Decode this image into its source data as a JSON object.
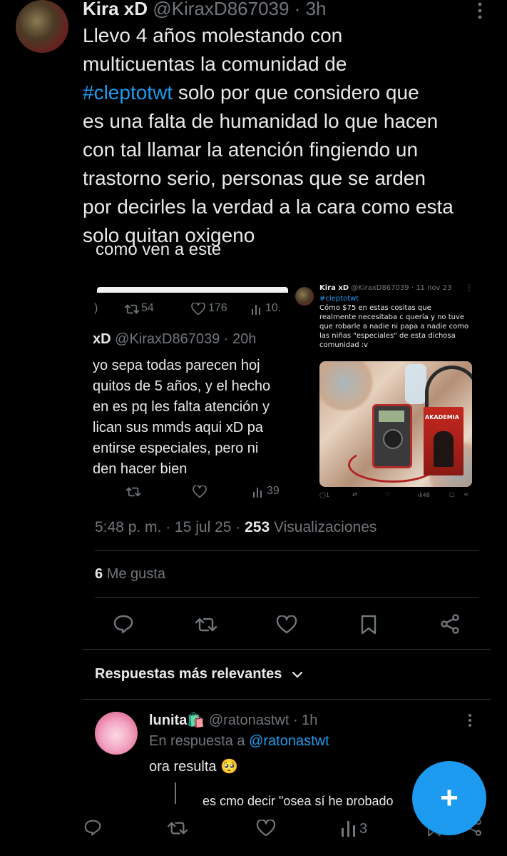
{
  "tweet": {
    "author_name": "Kira xD",
    "handle": "@KiraxD867039",
    "time": "· 3h",
    "text_lines": [
      "Llevo 4 años molestando con",
      "multicuentas la comunidad de",
      "solo por que considero que",
      "es una falta de humanidad lo que hacen",
      "con tal llamar la atención fingiendo un",
      "trastorno serio, personas que se arden",
      "por decirles la verdad a la cara como esta",
      "solo quitan oxigeno"
    ],
    "hashtag": "#cleptotwt",
    "cut_caption": "como ven a este",
    "timestamp": "5:48 p. m. · 15 jul 25 ·",
    "views_count": "253",
    "views_label": "Visualizaciones",
    "likes_count": "6",
    "likes_label": "Me gusta"
  },
  "left_screenshot": {
    "retweets": "54",
    "likes": "176",
    "views": "10.",
    "header_name": "xD",
    "header_handle": "@KiraxD867039 · 20h",
    "lines": [
      "yo sepa todas parecen hoj",
      "quitos de 5 años, y el hecho",
      "en es pq les falta atención y",
      "lican sus mmds aqui xD pa",
      "entirse especiales, pero ni",
      "den hacer bien"
    ],
    "bottom_views": "39"
  },
  "right_screenshot": {
    "name": "Kira xD",
    "handle_time": "@KiraxD867039 · 11 nov 23",
    "hashtag": "#cleptotwt",
    "lines": [
      "Cómo $75 en estas cositas que",
      "realmente necesitaba c quería y no tuve",
      "que robarle a nadie ni papa a nadie como",
      "las niñas \"especiales\" de esta dichosa",
      "comunidad :v"
    ],
    "reply_count": "1",
    "views": "48",
    "book_label": "AKADEMIA"
  },
  "replies_header": {
    "label": "Respuestas más relevantes"
  },
  "reply": {
    "name": "lunita",
    "emoji": "🛍️",
    "handle_time": "@ratonastwt · 1h",
    "reply_to_prefix": "En respuesta a",
    "reply_to_handle": "@ratonastwt",
    "text": "ora resulta",
    "text_emoji": "🥺",
    "quoted_partial": "es cmo decir \"osea sí he probado",
    "views": "3"
  },
  "fab": {
    "label": "+"
  },
  "colors": {
    "accent": "#1d9bf0",
    "muted": "#71767b",
    "text": "#e7e9ea",
    "divider": "#2f3336"
  }
}
